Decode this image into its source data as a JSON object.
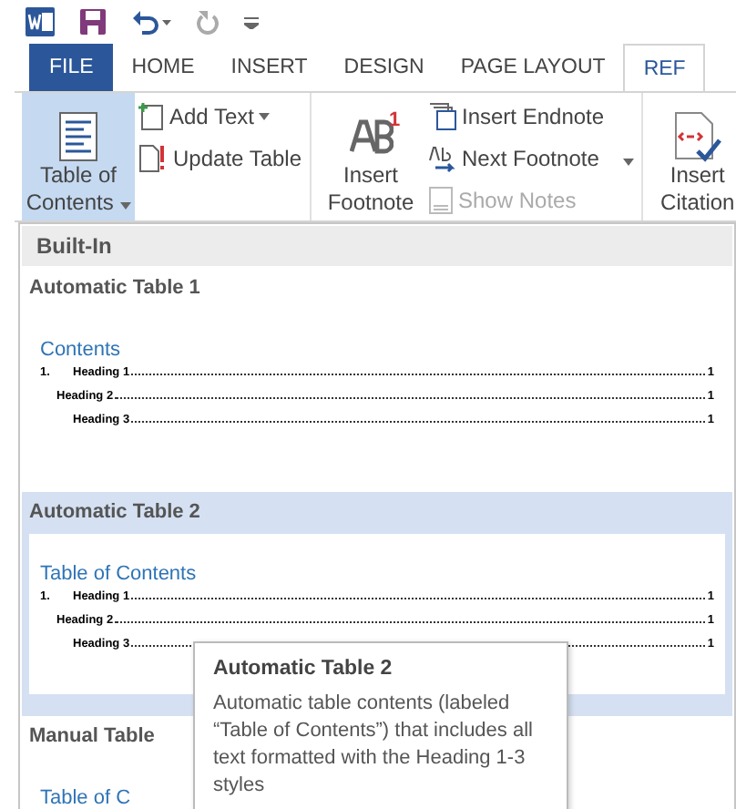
{
  "tabs": [
    {
      "label": "FILE",
      "kind": "file",
      "selected": false
    },
    {
      "label": "HOME",
      "kind": "tab",
      "selected": false
    },
    {
      "label": "INSERT",
      "kind": "tab",
      "selected": false
    },
    {
      "label": "DESIGN",
      "kind": "tab",
      "selected": false
    },
    {
      "label": "PAGE LAYOUT",
      "kind": "tab",
      "selected": false
    },
    {
      "label": "REF",
      "kind": "tab",
      "selected": true
    }
  ],
  "ribbon": {
    "toc": {
      "label": "Table of Contents",
      "selected": true
    },
    "small_1": [
      {
        "label": "Add Text",
        "dropdown": true
      },
      {
        "label": "Update Table",
        "dropdown": false
      }
    ],
    "footnote": {
      "label": "Insert Footnote",
      "superscript": "1"
    },
    "small_2": [
      {
        "label": "Insert Endnote",
        "dropdown": false,
        "disabled": false
      },
      {
        "label": "Next Footnote",
        "dropdown": true,
        "disabled": false
      },
      {
        "label": "Show Notes",
        "dropdown": false,
        "disabled": true
      }
    ],
    "citation": {
      "label": "Insert Citation"
    }
  },
  "menu": {
    "section": "Built-In",
    "items": [
      {
        "title": "Automatic Table 1",
        "selected": false,
        "heading": "Contents",
        "entries": [
          {
            "number": "1.",
            "text": "Heading 1",
            "page": "1"
          },
          {
            "text": "Heading 2",
            "page": "1"
          },
          {
            "text": "Heading 3",
            "page": "1"
          }
        ]
      },
      {
        "title": "Automatic Table 2",
        "selected": true,
        "heading": "Table of Contents",
        "entries": [
          {
            "number": "1.",
            "text": "Heading 1",
            "page": "1"
          },
          {
            "text": "Heading 2",
            "page": "1"
          },
          {
            "text": "Heading 3",
            "page": "1"
          }
        ]
      },
      {
        "title": "Manual Table",
        "selected": false,
        "heading": "Table of C"
      }
    ]
  },
  "tooltip": {
    "title": "Automatic Table 2",
    "text": "Automatic table contents (labeled “Table of Contents”) that includes all text formatted with the Heading 1-3 styles"
  }
}
